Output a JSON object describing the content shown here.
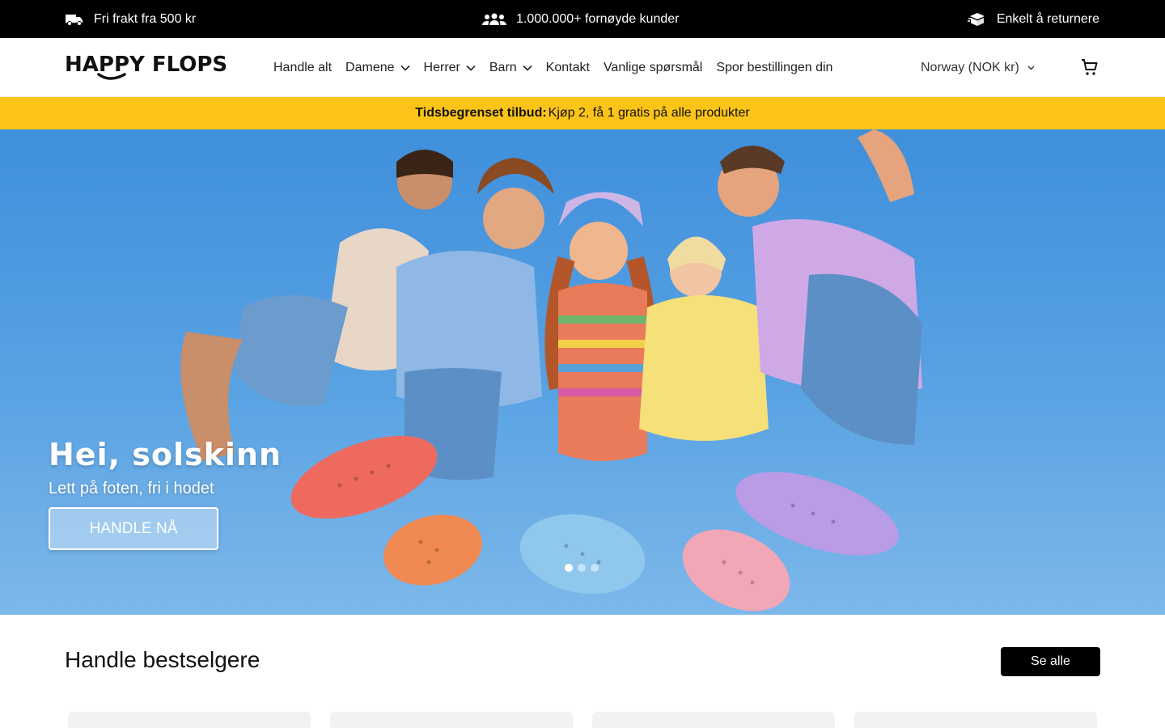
{
  "topbar": {
    "shipping": "Fri frakt fra 500 kr",
    "customers": "1.000.000+ fornøyde kunder",
    "returns": "Enkelt å returnere"
  },
  "header": {
    "logo_text": "HAPPY FLOPS",
    "nav": [
      {
        "label": "Handle alt",
        "has_dropdown": false
      },
      {
        "label": "Damene",
        "has_dropdown": true
      },
      {
        "label": "Herrer",
        "has_dropdown": true
      },
      {
        "label": "Barn",
        "has_dropdown": true
      },
      {
        "label": "Kontakt",
        "has_dropdown": false
      },
      {
        "label": "Vanlige spørsmål",
        "has_dropdown": false
      },
      {
        "label": "Spor bestillingen din",
        "has_dropdown": false
      }
    ],
    "country": "Norway (NOK kr)",
    "cart_icon": "cart-icon"
  },
  "promo": {
    "bold": "Tidsbegrenset tilbud:",
    "text": "Kjøp 2, få 1 gratis på alle produkter"
  },
  "hero": {
    "title": "Hei, solskinn",
    "subtitle": "Lett på foten, fri i hodet",
    "button": "HANDLE NÅ",
    "slides": 3,
    "active_slide": 1
  },
  "bestsellers": {
    "title": "Handle bestselgere",
    "see_all": "Se alle",
    "cards": 4
  },
  "colors": {
    "topbar": "#000000",
    "promo": "#fcc418",
    "sky": "#4a98df"
  }
}
